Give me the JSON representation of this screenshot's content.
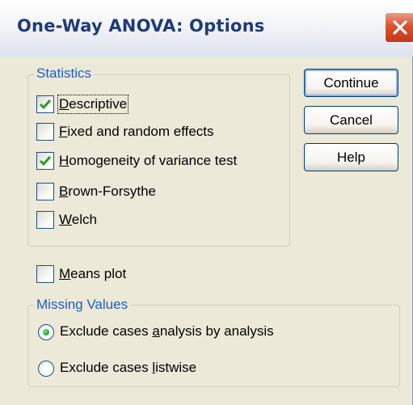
{
  "window": {
    "title": "One-Way ANOVA: Options"
  },
  "statistics": {
    "legend": "Statistics",
    "options": [
      {
        "pre": "",
        "u": "D",
        "post": "escriptive",
        "checked": true
      },
      {
        "pre": "",
        "u": "F",
        "post": "ixed and random effects",
        "checked": false
      },
      {
        "pre": "",
        "u": "H",
        "post": "omogeneity of variance test",
        "checked": true
      },
      {
        "pre": "",
        "u": "B",
        "post": "rown-Forsythe",
        "checked": false
      },
      {
        "pre": "",
        "u": "W",
        "post": "elch",
        "checked": false
      }
    ]
  },
  "means_plot": {
    "pre": "",
    "u": "M",
    "post": "eans plot",
    "checked": false
  },
  "missing_values": {
    "legend": "Missing Values",
    "options": [
      {
        "pre": "Exclude cases ",
        "u": "a",
        "post": "nalysis by analysis",
        "selected": true
      },
      {
        "pre": "Exclude cases ",
        "u": "l",
        "post": "istwise",
        "selected": false
      }
    ]
  },
  "buttons": {
    "continue": "Continue",
    "cancel": "Cancel",
    "help": "Help"
  },
  "colors": {
    "check": "#21A121",
    "legend": "#1F5DC4",
    "close": "#D9532F"
  }
}
